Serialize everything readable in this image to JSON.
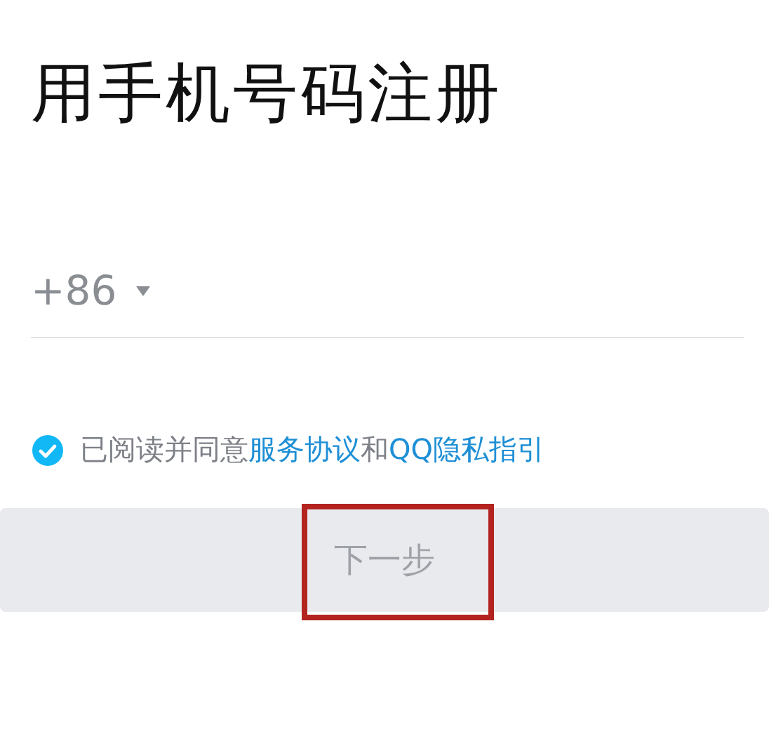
{
  "title": "用手机号码注册",
  "phone": {
    "country_code": "+86"
  },
  "agreement": {
    "checked": true,
    "parts": [
      {
        "kind": "text",
        "text": "已阅读并同意"
      },
      {
        "kind": "link",
        "text": "服务协议"
      },
      {
        "kind": "text",
        "text": "和"
      },
      {
        "kind": "link",
        "text": "QQ隐私指引"
      }
    ]
  },
  "next_button": {
    "label": "下一步",
    "disabled": true,
    "highlighted": true
  }
}
